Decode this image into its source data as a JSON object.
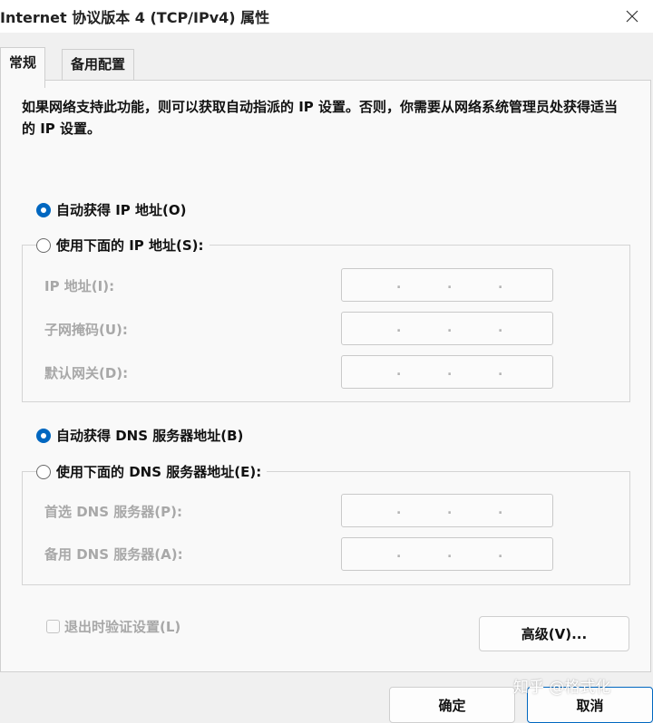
{
  "window": {
    "title": "Internet 协议版本 4 (TCP/IPv4) 属性"
  },
  "tabs": [
    {
      "label": "常规"
    },
    {
      "label": "备用配置"
    }
  ],
  "description": "如果网络支持此功能，则可以获取自动指派的 IP 设置。否则，你需要从网络系统管理员处获得适当的 IP 设置。",
  "ip_options": {
    "auto": {
      "label": "自动获得 IP 地址(O)",
      "checked": true
    },
    "manual": {
      "label": "使用下面的 IP 地址(S):",
      "checked": false
    }
  },
  "ip_fields": [
    {
      "label": "IP 地址(I):",
      "value": ""
    },
    {
      "label": "子网掩码(U):",
      "value": ""
    },
    {
      "label": "默认网关(D):",
      "value": ""
    }
  ],
  "dns_options": {
    "auto": {
      "label": "自动获得 DNS 服务器地址(B)",
      "checked": true
    },
    "manual": {
      "label": "使用下面的 DNS 服务器地址(E):",
      "checked": false
    }
  },
  "dns_fields": [
    {
      "label": "首选 DNS 服务器(P):",
      "value": ""
    },
    {
      "label": "备用 DNS 服务器(A):",
      "value": ""
    }
  ],
  "validate_on_exit": {
    "label": "退出时验证设置(L)",
    "checked": false,
    "disabled": true
  },
  "buttons": {
    "advanced": "高级(V)...",
    "ok": "确定",
    "cancel": "取消"
  },
  "watermark": "知乎 @格式化",
  "colors": {
    "accent": "#0067c0",
    "disabled_text": "#a8a8a8"
  }
}
